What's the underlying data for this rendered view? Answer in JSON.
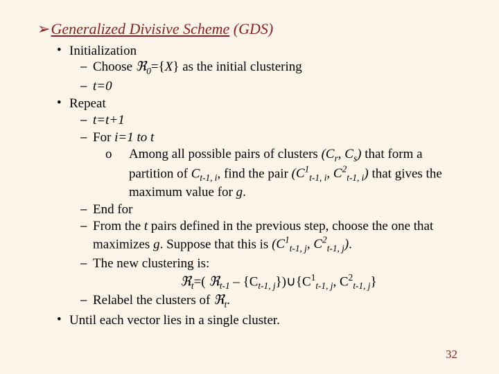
{
  "title": {
    "arrow": "➢",
    "underlined": "Generalized Divisive Scheme",
    "tail": " (GDS)"
  },
  "init": {
    "label": "Initialization",
    "choose_pre": "Choose ",
    "choose_post": " as the initial clustering",
    "tline": "t=0"
  },
  "repeat": {
    "label": "Repeat",
    "t_inc": "t=t+1",
    "for_pre": "For ",
    "for_cond": "i=1 to t",
    "among1": "Among all possible pairs of clusters ",
    "among_pair": "(Cᵣ, Cₛ)",
    "among2": " that form a partition of ",
    "among_C": "C",
    "among_sub": "t-1, i",
    "among3": ", find the pair ",
    "pair_open": "(C",
    "sup1": "1",
    "pair_sub": "t-1, i",
    "pair_mid": ", C",
    "sup2": "2",
    "pair_close": ")",
    "among4": " that gives the maximum value for ",
    "g": "g",
    "period": ".",
    "endfor": "End for",
    "from1": "From the ",
    "from_t": "t",
    "from2": " pairs defined in the previous step, choose the one that maximizes ",
    "from3": ". Suppose that this is ",
    "j_sub": "t-1, j",
    "newclust": "The new clustering is:",
    "eq_pre": "ℜ",
    "eq_sub_t": "t",
    "eq_mid1": "=( ",
    "eq_sub_tm1": "t-1",
    "eq_mid2": " – {C",
    "eq_setclose": "})∪{C",
    "eq_comma": ", C",
    "eq_end": "}",
    "relabel1": "Relabel the clusters of ",
    "relabel_sub": "t",
    "relabel2": "."
  },
  "until": "Until each vector lies in a single cluster.",
  "o_glyph": "o",
  "sigma": "ℜ",
  "X": "X",
  "page": "32"
}
